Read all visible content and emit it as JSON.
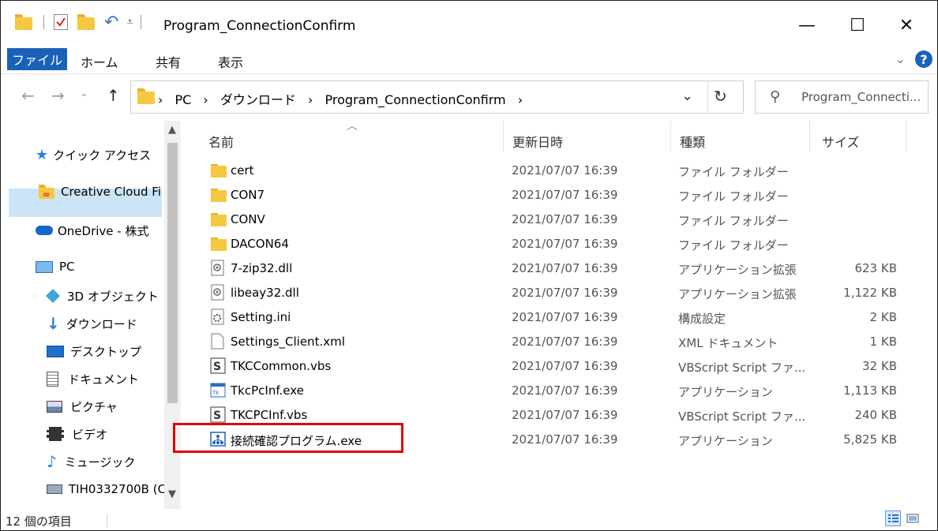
{
  "window": {
    "title": "Program_ConnectionConfirm",
    "controls": {
      "minimize": "—",
      "maximize": "☐",
      "close": "✕"
    }
  },
  "ribbon": {
    "tabs": [
      "ファイル",
      "ホーム",
      "共有",
      "表示"
    ],
    "expand_icon": "chevron-down-icon",
    "help": "?"
  },
  "address": {
    "breadcrumbs": [
      "PC",
      "ダウンロード",
      "Program_ConnectionConfirm"
    ],
    "search_placeholder": "Program_Connecti..."
  },
  "nav": {
    "items": [
      {
        "label": "クイック アクセス",
        "icon": "star-icon"
      },
      {
        "label": "Creative Cloud Fi",
        "icon": "creative-cloud-icon"
      },
      {
        "label": "OneDrive - 株式",
        "icon": "cloud-icon"
      },
      {
        "label": "PC",
        "icon": "pc-icon"
      },
      {
        "label": "3D オブジェクト",
        "icon": "cube-icon"
      },
      {
        "label": "ダウンロード",
        "icon": "download-icon"
      },
      {
        "label": "デスクトップ",
        "icon": "desktop-icon"
      },
      {
        "label": "ドキュメント",
        "icon": "document-icon"
      },
      {
        "label": "ピクチャ",
        "icon": "picture-icon"
      },
      {
        "label": "ビデオ",
        "icon": "video-icon"
      },
      {
        "label": "ミュージック",
        "icon": "music-icon"
      },
      {
        "label": "TIH0332700B (C",
        "icon": "network-drive-icon"
      }
    ],
    "selected": "ダウンロード"
  },
  "columns": {
    "name": "名前",
    "date": "更新日時",
    "type": "種類",
    "size": "サイズ"
  },
  "files": [
    {
      "name": "cert",
      "date": "2021/07/07 16:39",
      "type": "ファイル フォルダー",
      "size": "",
      "icon": "folder-icon"
    },
    {
      "name": "CON7",
      "date": "2021/07/07 16:39",
      "type": "ファイル フォルダー",
      "size": "",
      "icon": "folder-icon"
    },
    {
      "name": "CONV",
      "date": "2021/07/07 16:39",
      "type": "ファイル フォルダー",
      "size": "",
      "icon": "folder-icon"
    },
    {
      "name": "DACON64",
      "date": "2021/07/07 16:39",
      "type": "ファイル フォルダー",
      "size": "",
      "icon": "folder-icon"
    },
    {
      "name": "7-zip32.dll",
      "date": "2021/07/07 16:39",
      "type": "アプリケーション拡張",
      "size": "623 KB",
      "icon": "dll-icon"
    },
    {
      "name": "libeay32.dll",
      "date": "2021/07/07 16:39",
      "type": "アプリケーション拡張",
      "size": "1,122 KB",
      "icon": "dll-icon"
    },
    {
      "name": "Setting.ini",
      "date": "2021/07/07 16:39",
      "type": "構成設定",
      "size": "2 KB",
      "icon": "settings-file-icon"
    },
    {
      "name": "Settings_Client.xml",
      "date": "2021/07/07 16:39",
      "type": "XML ドキュメント",
      "size": "1 KB",
      "icon": "blank-file-icon"
    },
    {
      "name": "TKCCommon.vbs",
      "date": "2021/07/07 16:39",
      "type": "VBScript Script ファ...",
      "size": "32 KB",
      "icon": "script-icon"
    },
    {
      "name": "TkcPcInf.exe",
      "date": "2021/07/07 16:39",
      "type": "アプリケーション",
      "size": "1,113 KB",
      "icon": "exe-icon"
    },
    {
      "name": "TKCPCInf.vbs",
      "date": "2021/07/07 16:39",
      "type": "VBScript Script ファ...",
      "size": "240 KB",
      "icon": "script-icon"
    },
    {
      "name": "接続確認プログラム.exe",
      "date": "2021/07/07 16:39",
      "type": "アプリケーション",
      "size": "5,825 KB",
      "icon": "network-exe-icon"
    }
  ],
  "status": {
    "item_count": "12 個の項目"
  },
  "colors": {
    "accent": "#1a62b8",
    "highlight": "#e00000",
    "nav_selected": "#cce4f7",
    "folder": "#f5c842"
  }
}
